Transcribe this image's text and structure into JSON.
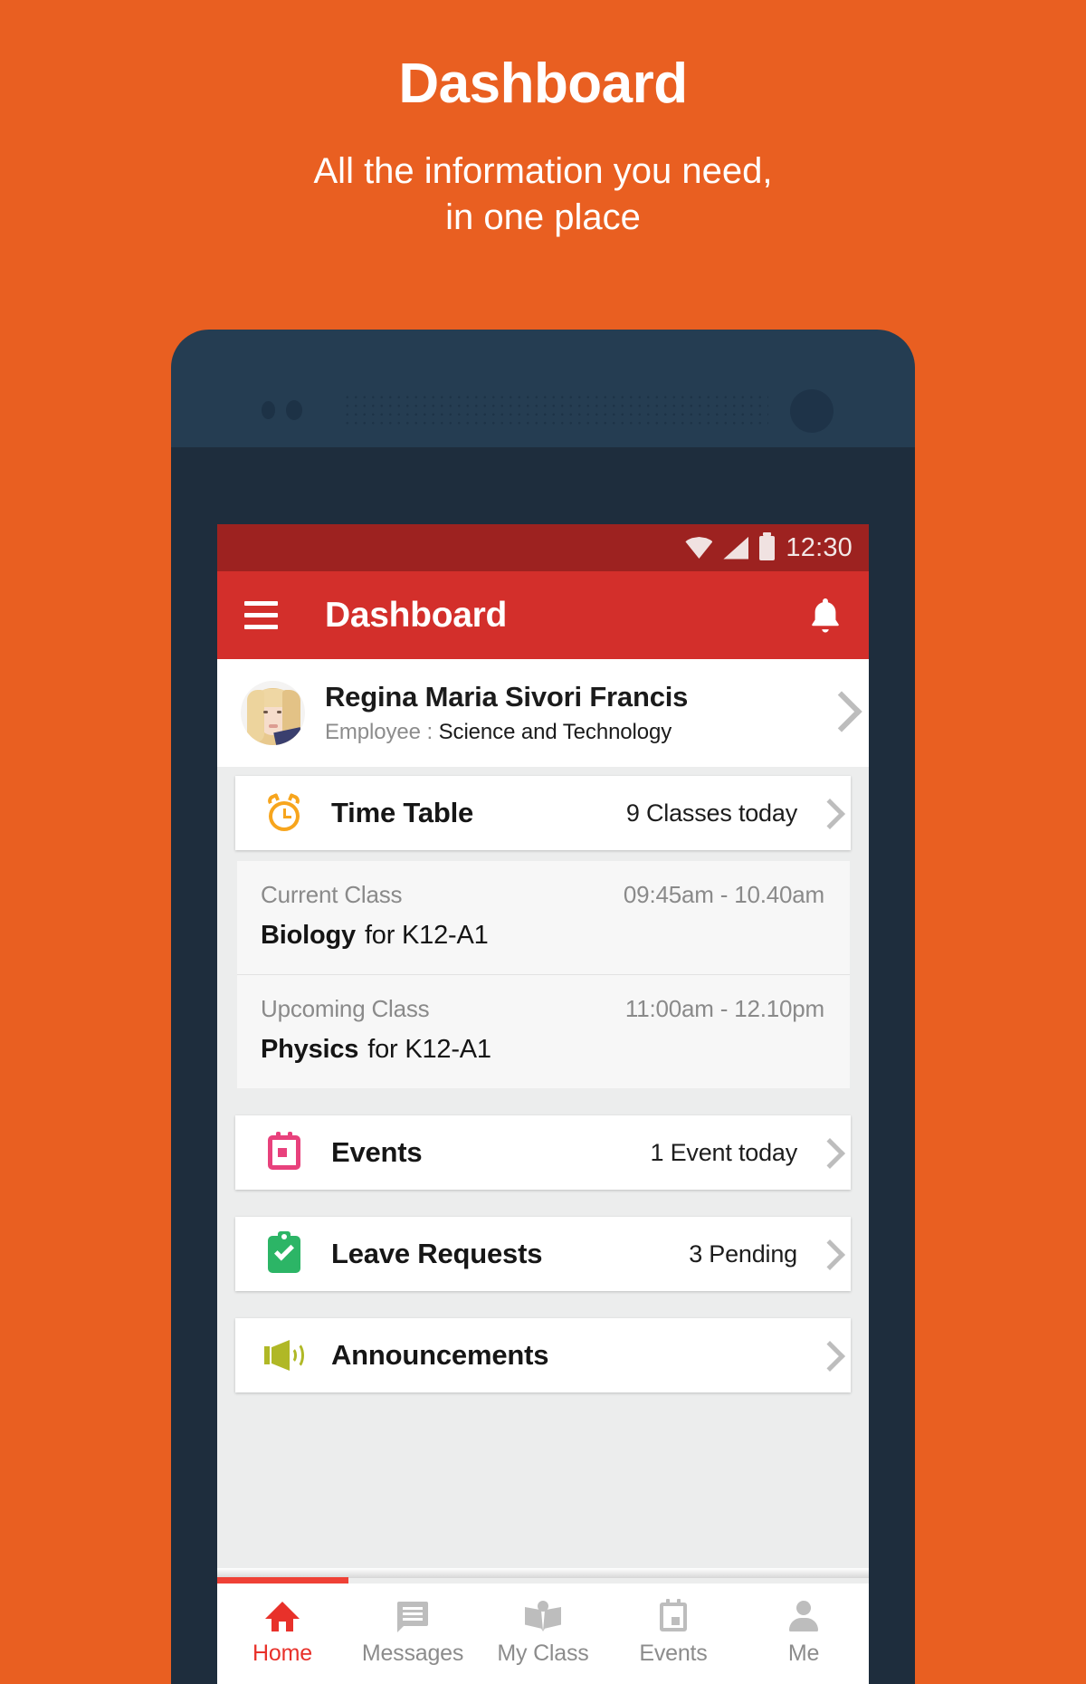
{
  "promo": {
    "title": "Dashboard",
    "subtitle_line1": "All the information you need,",
    "subtitle_line2": "in one place"
  },
  "statusbar": {
    "time": "12:30",
    "icons": [
      "wifi-icon",
      "signal-icon",
      "battery-icon"
    ]
  },
  "appbar": {
    "menu_icon": "hamburger-menu-icon",
    "title": "Dashboard",
    "notification_icon": "bell-icon"
  },
  "profile": {
    "name": "Regina Maria Sivori Francis",
    "role_label": "Employee :",
    "role_value": "Science and Technology",
    "chevron_icon": "chevron-right-icon"
  },
  "cards": [
    {
      "id": "time-table",
      "icon": "alarm-clock-icon",
      "title": "Time Table",
      "meta": "9 Classes today",
      "chevron": "chevron-right-icon"
    },
    {
      "id": "events",
      "icon": "calendar-icon",
      "title": "Events",
      "meta": "1 Event today",
      "chevron": "chevron-right-icon"
    },
    {
      "id": "leave-requests",
      "icon": "clipboard-check-icon",
      "title": "Leave Requests",
      "meta": "3 Pending",
      "chevron": "chevron-right-icon"
    },
    {
      "id": "announcements",
      "icon": "megaphone-icon",
      "title": "Announcements",
      "meta": "",
      "chevron": "chevron-right-icon"
    }
  ],
  "schedule": [
    {
      "label": "Current Class",
      "time": "09:45am - 10.40am",
      "subject": "Biology",
      "for": "for K12-A1"
    },
    {
      "label": "Upcoming Class",
      "time": "11:00am - 12.10pm",
      "subject": "Physics",
      "for": "for K12-A1"
    }
  ],
  "bottom_nav": {
    "active": "Home",
    "tabs": [
      {
        "label": "Home",
        "icon": "home-icon"
      },
      {
        "label": "Messages",
        "icon": "message-icon"
      },
      {
        "label": "My Class",
        "icon": "open-book-icon"
      },
      {
        "label": "Events",
        "icon": "calendar-icon"
      },
      {
        "label": "Me",
        "icon": "person-icon"
      }
    ]
  },
  "colors": {
    "background_orange": "#e95f21",
    "appbar_red": "#d32f2b",
    "statusbar_red": "#9d2220",
    "accent_red": "#e8312a",
    "alarm_orange": "#f7a51d",
    "events_pink": "#e8417c",
    "leave_green": "#2cb566",
    "announce_olive": "#b0b826",
    "phone_navy": "#1e2d3d"
  }
}
